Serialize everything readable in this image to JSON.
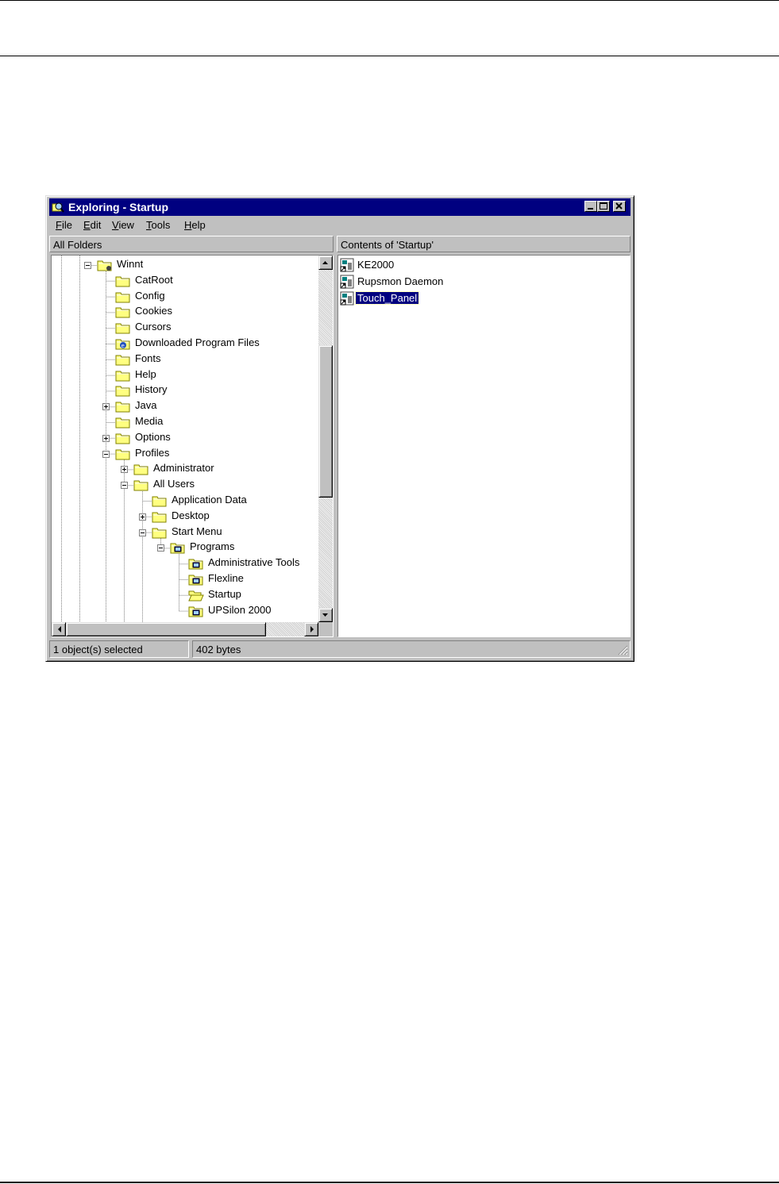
{
  "window": {
    "title": "Exploring - Startup",
    "menu": [
      {
        "u": "F",
        "rest": "ile"
      },
      {
        "u": "E",
        "rest": "dit"
      },
      {
        "u": "V",
        "rest": "iew"
      },
      {
        "u": "T",
        "rest": "ools"
      },
      {
        "u": "H",
        "rest": "elp"
      }
    ]
  },
  "left_pane": {
    "header": "All Folders",
    "tree": [
      {
        "label": "Winnt",
        "level": 0,
        "expander": "minus",
        "icon": "special-folder-icon"
      },
      {
        "label": "CatRoot",
        "level": 1,
        "expander": "none",
        "icon": "folder-icon"
      },
      {
        "label": "Config",
        "level": 1,
        "expander": "none",
        "icon": "folder-icon"
      },
      {
        "label": "Cookies",
        "level": 1,
        "expander": "none",
        "icon": "folder-icon"
      },
      {
        "label": "Cursors",
        "level": 1,
        "expander": "none",
        "icon": "folder-icon"
      },
      {
        "label": "Downloaded Program Files",
        "level": 1,
        "expander": "none",
        "icon": "ie-folder-icon"
      },
      {
        "label": "Fonts",
        "level": 1,
        "expander": "none",
        "icon": "folder-icon"
      },
      {
        "label": "Help",
        "level": 1,
        "expander": "none",
        "icon": "folder-icon"
      },
      {
        "label": "History",
        "level": 1,
        "expander": "none",
        "icon": "folder-icon"
      },
      {
        "label": "Java",
        "level": 1,
        "expander": "plus",
        "icon": "folder-icon"
      },
      {
        "label": "Media",
        "level": 1,
        "expander": "none",
        "icon": "folder-icon"
      },
      {
        "label": "Options",
        "level": 1,
        "expander": "plus",
        "icon": "folder-icon"
      },
      {
        "label": "Profiles",
        "level": 1,
        "expander": "minus",
        "icon": "folder-icon"
      },
      {
        "label": "Administrator",
        "level": 2,
        "expander": "plus",
        "icon": "folder-icon"
      },
      {
        "label": "All Users",
        "level": 2,
        "expander": "minus",
        "icon": "folder-icon"
      },
      {
        "label": "Application Data",
        "level": 3,
        "expander": "none",
        "icon": "folder-icon"
      },
      {
        "label": "Desktop",
        "level": 3,
        "expander": "plus",
        "icon": "folder-icon"
      },
      {
        "label": "Start Menu",
        "level": 3,
        "expander": "minus",
        "icon": "folder-icon"
      },
      {
        "label": "Programs",
        "level": 4,
        "expander": "minus",
        "icon": "program-group-icon"
      },
      {
        "label": "Administrative Tools",
        "level": 5,
        "expander": "none",
        "icon": "program-group-icon"
      },
      {
        "label": "Flexline",
        "level": 5,
        "expander": "none",
        "icon": "program-group-icon"
      },
      {
        "label": "Startup",
        "level": 5,
        "expander": "none",
        "icon": "open-folder-icon"
      },
      {
        "label": "UPSilon 2000",
        "level": 5,
        "expander": "none",
        "icon": "program-group-icon"
      }
    ]
  },
  "right_pane": {
    "header": "Contents of 'Startup'",
    "items": [
      {
        "label": "KE2000",
        "icon": "shortcut-icon",
        "selected": false
      },
      {
        "label": "Rupsmon Daemon",
        "icon": "shortcut-icon",
        "selected": false
      },
      {
        "label": "Touch_Panel",
        "icon": "shortcut-icon",
        "selected": true
      }
    ]
  },
  "status": {
    "selection": "1 object(s) selected",
    "size": "402 bytes"
  },
  "colors": {
    "title_bar": "#000080",
    "window_face": "#c0c0c0",
    "folder": "#ffff80",
    "selection": "#000080"
  }
}
